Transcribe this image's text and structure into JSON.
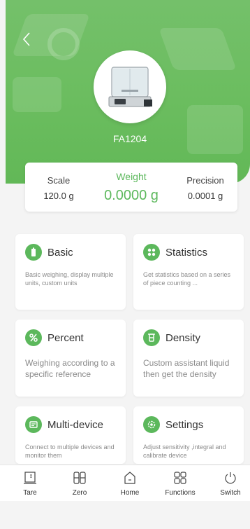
{
  "header": {
    "device_name": "FA1204",
    "back_icon": "chevron-left-icon",
    "accent_color": "#6bbd5f"
  },
  "readout": {
    "scale_label": "Scale",
    "scale_value": "120.0 g",
    "weight_label": "Weight",
    "weight_value": "0.0000 g",
    "precision_label": "Precision",
    "precision_value": "0.0001 g"
  },
  "cards": {
    "basic": {
      "title": "Basic",
      "desc": "Basic weighing, display multiple units, custom units",
      "icon": "battery-icon"
    },
    "statistics": {
      "title": "Statistics",
      "desc": "Get statistics based on a series of piece counting ...",
      "icon": "grid-dots-icon"
    },
    "percent": {
      "title": "Percent",
      "desc": "Weighing according to a specific reference",
      "icon": "percent-icon"
    },
    "density": {
      "title": "Density",
      "desc": "Custom assistant liquid then get the density",
      "icon": "flask-icon"
    },
    "multi": {
      "title": "Multi-device",
      "desc": "Connect to multiple devices and monitor them",
      "icon": "devices-icon"
    },
    "settings": {
      "title": "Settings",
      "desc": "Adjust sensitivity ,integral and calibrate device",
      "icon": "gear-icon"
    }
  },
  "tabbar": {
    "tare": "Tare",
    "zero": "Zero",
    "home": "Home",
    "functions": "Functions",
    "switch": "Switch"
  }
}
